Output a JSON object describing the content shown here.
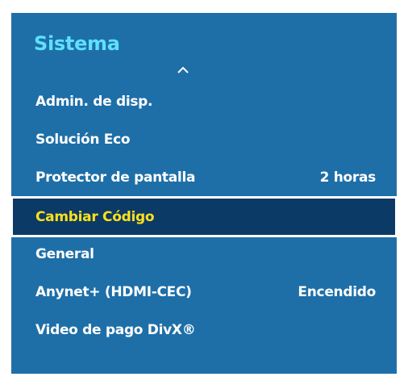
{
  "menu": {
    "title": "Sistema",
    "scroll_up_icon": "chevron-up-icon",
    "items": [
      {
        "label": "Admin. de disp.",
        "value": ""
      },
      {
        "label": "Solución Eco",
        "value": ""
      },
      {
        "label": "Protector de pantalla",
        "value": "2 horas"
      },
      {
        "label": "Cambiar Código",
        "value": ""
      },
      {
        "label": "General",
        "value": ""
      },
      {
        "label": "Anynet+ (HDMI-CEC)",
        "value": "Encendido"
      },
      {
        "label": "Video de pago DivX®",
        "value": ""
      }
    ],
    "selected_index": 3
  },
  "colors": {
    "panel_background": "#1e6fa8",
    "title_color": "#5fe0ff",
    "selected_background": "#0b3a66",
    "selected_text": "#ffe01a"
  }
}
